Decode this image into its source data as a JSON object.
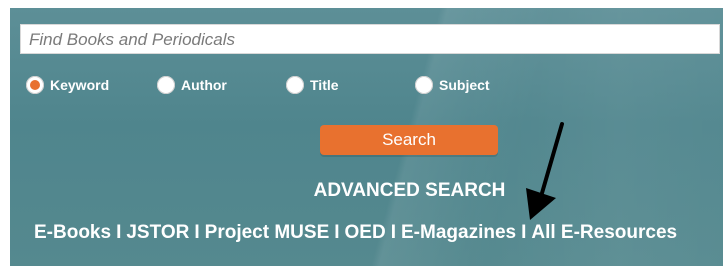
{
  "search": {
    "placeholder": "Find Books and Periodicals"
  },
  "search_types": [
    {
      "label": "Keyword",
      "selected": true
    },
    {
      "label": "Author",
      "selected": false
    },
    {
      "label": "Title",
      "selected": false
    },
    {
      "label": "Subject",
      "selected": false
    }
  ],
  "search_button": {
    "label": "Search"
  },
  "advanced_search": {
    "label": "ADVANCED SEARCH"
  },
  "resource_links": {
    "separator": "I",
    "items": [
      "E-Books",
      "JSTOR",
      "Project MUSE",
      "OED",
      "E-Magazines",
      "All E-Resources"
    ]
  },
  "colors": {
    "accent": "#e8712f",
    "panel": "#55898f",
    "text": "#ffffff"
  },
  "annotation": {
    "icon": "arrow-pointing-down-left-icon"
  }
}
